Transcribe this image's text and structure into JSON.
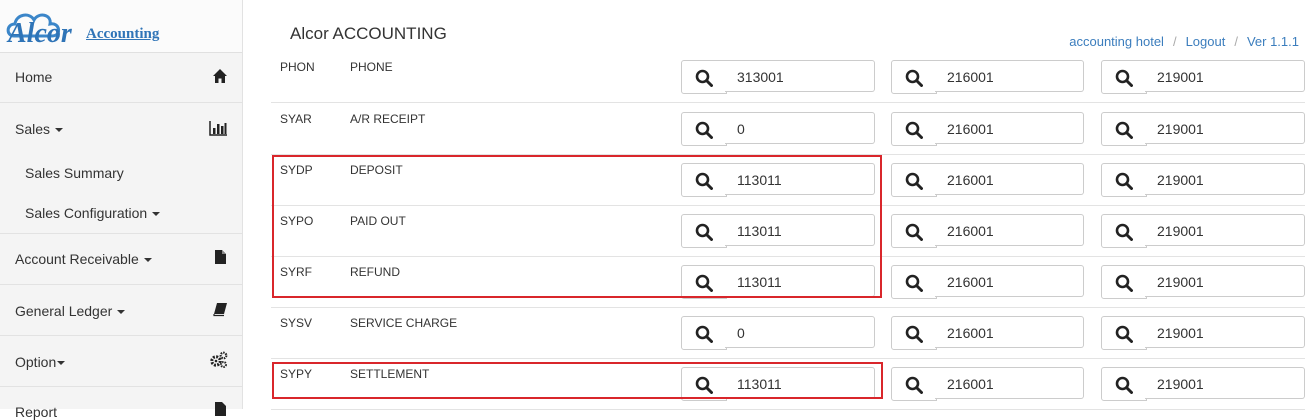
{
  "brand": {
    "logo_text": "Alcor",
    "accounting_link": "Accounting"
  },
  "header": {
    "title": "Alcor ACCOUNTING",
    "user": "accounting hotel",
    "logout": "Logout",
    "version": "Ver 1.1.1"
  },
  "sidebar": {
    "items": [
      {
        "label": "Home",
        "icon": "home-icon"
      },
      {
        "label": "Sales",
        "icon": "bar-chart-icon",
        "dropdown": true
      },
      {
        "label": "Sales Summary",
        "sub": true
      },
      {
        "label": "Sales Configuration",
        "sub": true,
        "dropdown": true
      },
      {
        "label": "Account Receivable",
        "icon": "file-icon",
        "dropdown": true
      },
      {
        "label": "General Ledger",
        "icon": "book-icon",
        "dropdown": true
      },
      {
        "label": "Option",
        "icon": "gears-icon",
        "dropdown": true
      },
      {
        "label": "Report",
        "icon": "file-icon"
      }
    ]
  },
  "rows": [
    {
      "code": "PHON",
      "desc": "PHONE",
      "acct1": "313001",
      "acct2": "216001",
      "acct3": "219001"
    },
    {
      "code": "SYAR",
      "desc": "A/R RECEIPT",
      "acct1": "0",
      "acct2": "216001",
      "acct3": "219001"
    },
    {
      "code": "SYDP",
      "desc": "DEPOSIT",
      "acct1": "113011",
      "acct2": "216001",
      "acct3": "219001"
    },
    {
      "code": "SYPO",
      "desc": "PAID OUT",
      "acct1": "113011",
      "acct2": "216001",
      "acct3": "219001"
    },
    {
      "code": "SYRF",
      "desc": "REFUND",
      "acct1": "113011",
      "acct2": "216001",
      "acct3": "219001"
    },
    {
      "code": "SYSV",
      "desc": "SERVICE CHARGE",
      "acct1": "0",
      "acct2": "216001",
      "acct3": "219001"
    },
    {
      "code": "SYPY",
      "desc": "SETTLEMENT",
      "acct1": "113011",
      "acct2": "216001",
      "acct3": "219001"
    }
  ],
  "colors": {
    "accent": "#2f74b7",
    "highlight": "#d9262b"
  }
}
